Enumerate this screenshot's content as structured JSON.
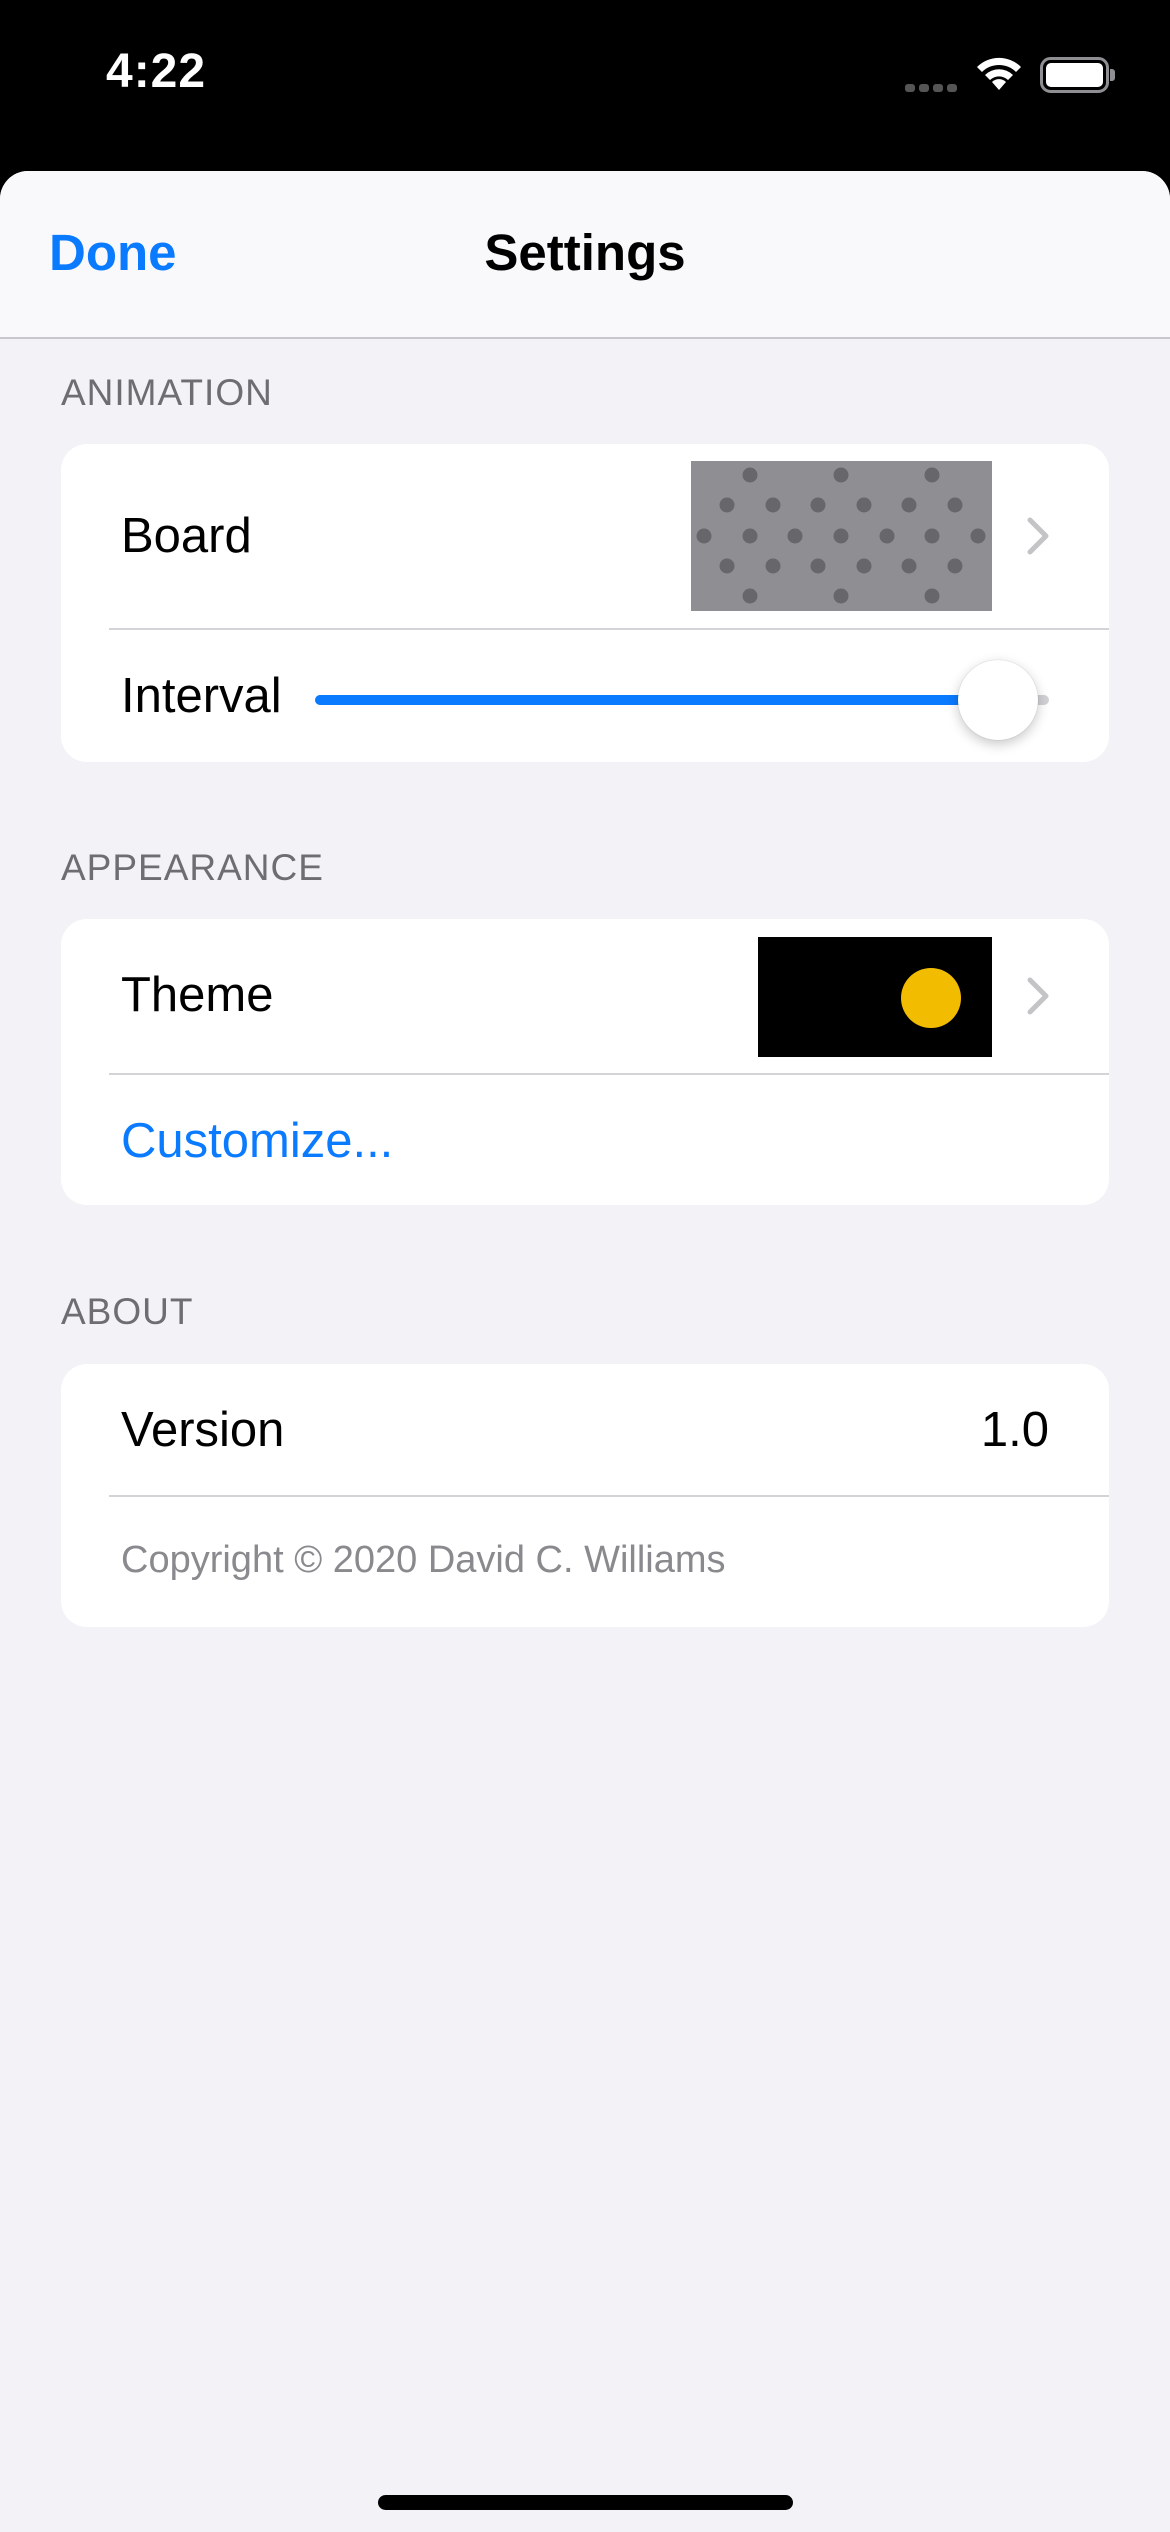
{
  "status_bar": {
    "time": "4:22",
    "icons": [
      "signal-icon",
      "wifi-icon",
      "battery-icon"
    ]
  },
  "nav": {
    "done_label": "Done",
    "title": "Settings"
  },
  "sections": {
    "animation": {
      "header": "ANIMATION",
      "board_label": "Board",
      "interval_label": "Interval",
      "interval_level_fraction": 0.93
    },
    "appearance": {
      "header": "APPEARANCE",
      "theme_label": "Theme",
      "theme_colors": {
        "background": "#000000",
        "accent": "#f2bd00"
      },
      "customize_label": "Customize..."
    },
    "about": {
      "header": "ABOUT",
      "version_label": "Version",
      "version_value": "1.0",
      "copyright": "Copyright © 2020 David C. Williams"
    }
  },
  "colors": {
    "accent": "#0a7aff",
    "background": "#f2f2f7",
    "card": "#ffffff",
    "board_preview": "#8e8e93"
  }
}
